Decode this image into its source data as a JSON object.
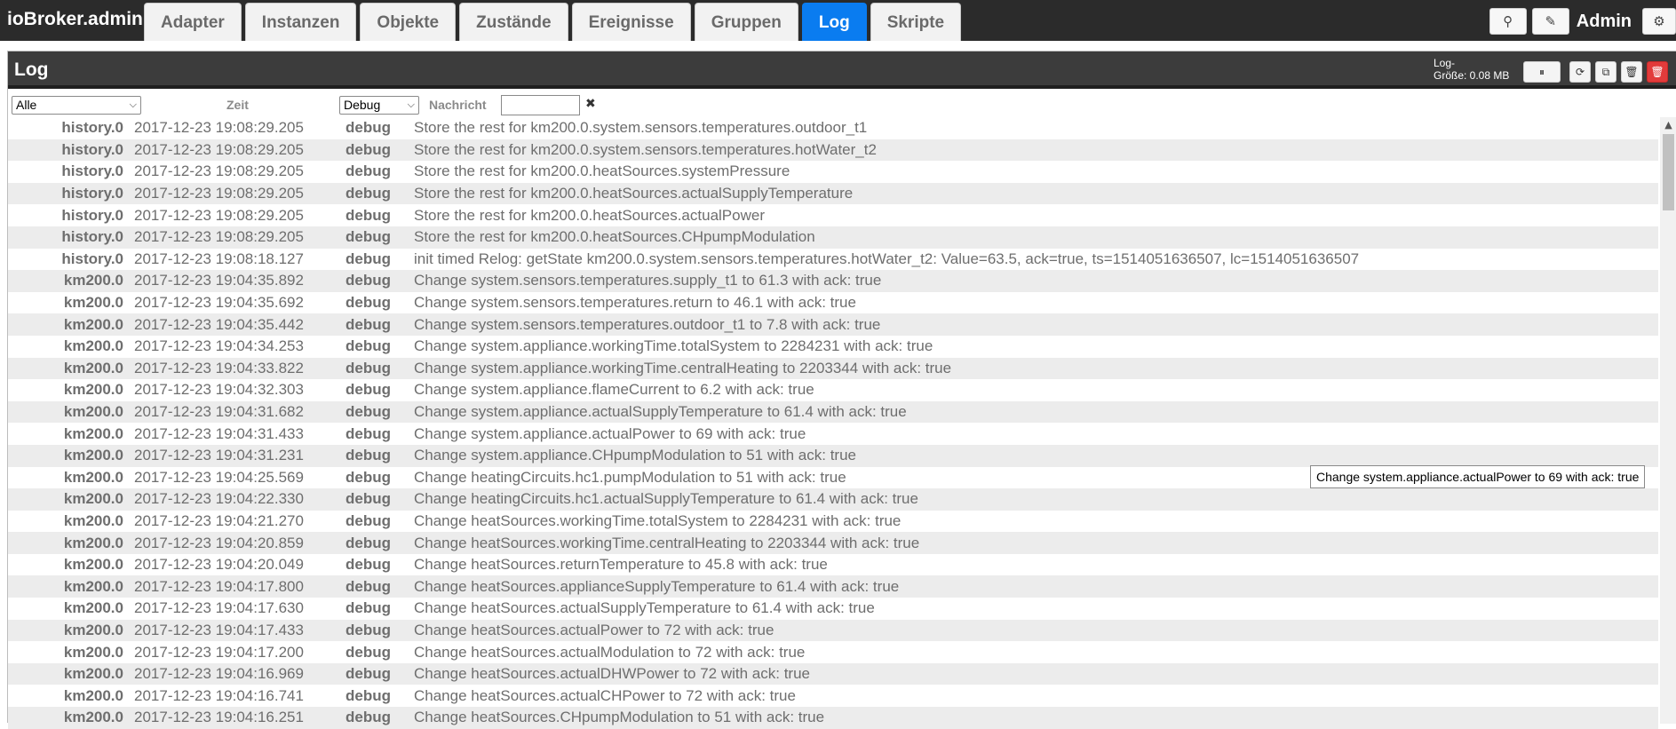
{
  "app": {
    "title": "ioBroker.admin"
  },
  "tabs": [
    {
      "label": "Adapter",
      "active": false
    },
    {
      "label": "Instanzen",
      "active": false
    },
    {
      "label": "Objekte",
      "active": false
    },
    {
      "label": "Zustände",
      "active": false
    },
    {
      "label": "Ereignisse",
      "active": false
    },
    {
      "label": "Gruppen",
      "active": false
    },
    {
      "label": "Log",
      "active": true
    },
    {
      "label": "Skripte",
      "active": false
    }
  ],
  "topbar": {
    "search_icon": "⚲",
    "edit_icon": "✎",
    "user": "Admin",
    "settings_icon": "⚙"
  },
  "panel": {
    "title": "Log",
    "log_size_label": "Log-",
    "log_size_value": "Größe: 0.08 MB",
    "buttons": {
      "pause": "⏸",
      "refresh": "⟳",
      "copy": "⧉",
      "delete": "🗑",
      "delete_all": "🗑"
    }
  },
  "filters": {
    "source_select": "Alle",
    "time_label": "Zeit",
    "severity_select": "Debug",
    "message_label": "Nachricht",
    "message_value": "",
    "clear": "✖"
  },
  "log_rows": [
    {
      "src": "history.0",
      "time": "2017-12-23 19:08:29.205",
      "sev": "debug",
      "msg": "Store the rest for km200.0.system.sensors.temperatures.outdoor_t1"
    },
    {
      "src": "history.0",
      "time": "2017-12-23 19:08:29.205",
      "sev": "debug",
      "msg": "Store the rest for km200.0.system.sensors.temperatures.hotWater_t2"
    },
    {
      "src": "history.0",
      "time": "2017-12-23 19:08:29.205",
      "sev": "debug",
      "msg": "Store the rest for km200.0.heatSources.systemPressure"
    },
    {
      "src": "history.0",
      "time": "2017-12-23 19:08:29.205",
      "sev": "debug",
      "msg": "Store the rest for km200.0.heatSources.actualSupplyTemperature"
    },
    {
      "src": "history.0",
      "time": "2017-12-23 19:08:29.205",
      "sev": "debug",
      "msg": "Store the rest for km200.0.heatSources.actualPower"
    },
    {
      "src": "history.0",
      "time": "2017-12-23 19:08:29.205",
      "sev": "debug",
      "msg": "Store the rest for km200.0.heatSources.CHpumpModulation"
    },
    {
      "src": "history.0",
      "time": "2017-12-23 19:08:18.127",
      "sev": "debug",
      "msg": "init timed Relog: getState km200.0.system.sensors.temperatures.hotWater_t2: Value=63.5, ack=true, ts=1514051636507, lc=1514051636507"
    },
    {
      "src": "km200.0",
      "time": "2017-12-23 19:04:35.892",
      "sev": "debug",
      "msg": "Change system.sensors.temperatures.supply_t1 to 61.3 with ack: true"
    },
    {
      "src": "km200.0",
      "time": "2017-12-23 19:04:35.692",
      "sev": "debug",
      "msg": "Change system.sensors.temperatures.return to 46.1 with ack: true"
    },
    {
      "src": "km200.0",
      "time": "2017-12-23 19:04:35.442",
      "sev": "debug",
      "msg": "Change system.sensors.temperatures.outdoor_t1 to 7.8 with ack: true"
    },
    {
      "src": "km200.0",
      "time": "2017-12-23 19:04:34.253",
      "sev": "debug",
      "msg": "Change system.appliance.workingTime.totalSystem to 2284231 with ack: true"
    },
    {
      "src": "km200.0",
      "time": "2017-12-23 19:04:33.822",
      "sev": "debug",
      "msg": "Change system.appliance.workingTime.centralHeating to 2203344 with ack: true"
    },
    {
      "src": "km200.0",
      "time": "2017-12-23 19:04:32.303",
      "sev": "debug",
      "msg": "Change system.appliance.flameCurrent to 6.2 with ack: true"
    },
    {
      "src": "km200.0",
      "time": "2017-12-23 19:04:31.682",
      "sev": "debug",
      "msg": "Change system.appliance.actualSupplyTemperature to 61.4 with ack: true"
    },
    {
      "src": "km200.0",
      "time": "2017-12-23 19:04:31.433",
      "sev": "debug",
      "msg": "Change system.appliance.actualPower to 69 with ack: true"
    },
    {
      "src": "km200.0",
      "time": "2017-12-23 19:04:31.231",
      "sev": "debug",
      "msg": "Change system.appliance.CHpumpModulation to 51 with ack: true"
    },
    {
      "src": "km200.0",
      "time": "2017-12-23 19:04:25.569",
      "sev": "debug",
      "msg": "Change heatingCircuits.hc1.pumpModulation to 51 with ack: true"
    },
    {
      "src": "km200.0",
      "time": "2017-12-23 19:04:22.330",
      "sev": "debug",
      "msg": "Change heatingCircuits.hc1.actualSupplyTemperature to 61.4 with ack: true"
    },
    {
      "src": "km200.0",
      "time": "2017-12-23 19:04:21.270",
      "sev": "debug",
      "msg": "Change heatSources.workingTime.totalSystem to 2284231 with ack: true"
    },
    {
      "src": "km200.0",
      "time": "2017-12-23 19:04:20.859",
      "sev": "debug",
      "msg": "Change heatSources.workingTime.centralHeating to 2203344 with ack: true"
    },
    {
      "src": "km200.0",
      "time": "2017-12-23 19:04:20.049",
      "sev": "debug",
      "msg": "Change heatSources.returnTemperature to 45.8 with ack: true"
    },
    {
      "src": "km200.0",
      "time": "2017-12-23 19:04:17.800",
      "sev": "debug",
      "msg": "Change heatSources.applianceSupplyTemperature to 61.4 with ack: true"
    },
    {
      "src": "km200.0",
      "time": "2017-12-23 19:04:17.630",
      "sev": "debug",
      "msg": "Change heatSources.actualSupplyTemperature to 61.4 with ack: true"
    },
    {
      "src": "km200.0",
      "time": "2017-12-23 19:04:17.433",
      "sev": "debug",
      "msg": "Change heatSources.actualPower to 72 with ack: true"
    },
    {
      "src": "km200.0",
      "time": "2017-12-23 19:04:17.200",
      "sev": "debug",
      "msg": "Change heatSources.actualModulation to 72 with ack: true"
    },
    {
      "src": "km200.0",
      "time": "2017-12-23 19:04:16.969",
      "sev": "debug",
      "msg": "Change heatSources.actualDHWPower to 72 with ack: true"
    },
    {
      "src": "km200.0",
      "time": "2017-12-23 19:04:16.741",
      "sev": "debug",
      "msg": "Change heatSources.actualCHPower to 72 with ack: true"
    },
    {
      "src": "km200.0",
      "time": "2017-12-23 19:04:16.251",
      "sev": "debug",
      "msg": "Change heatSources.CHpumpModulation to 51 with ack: true"
    }
  ],
  "tooltip": {
    "text": "Change system.appliance.actualPower to 69 with ack: true"
  }
}
